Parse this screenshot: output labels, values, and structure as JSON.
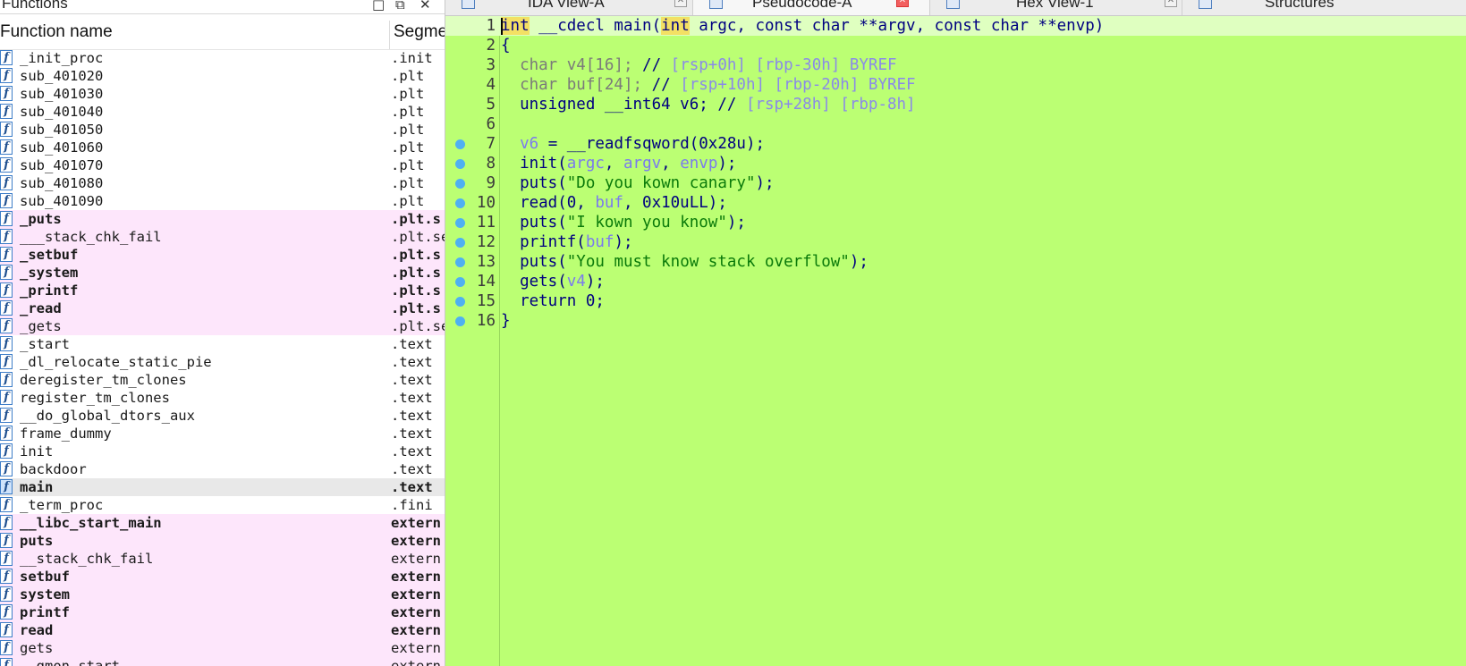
{
  "functions_panel": {
    "title": "Functions",
    "col_name": "Function name",
    "col_segment": "Segme",
    "rows": [
      {
        "name": "_init_proc",
        "segment": ".init",
        "style": "normal"
      },
      {
        "name": "sub_401020",
        "segment": ".plt",
        "style": "normal"
      },
      {
        "name": "sub_401030",
        "segment": ".plt",
        "style": "normal"
      },
      {
        "name": "sub_401040",
        "segment": ".plt",
        "style": "normal"
      },
      {
        "name": "sub_401050",
        "segment": ".plt",
        "style": "normal"
      },
      {
        "name": "sub_401060",
        "segment": ".plt",
        "style": "normal"
      },
      {
        "name": "sub_401070",
        "segment": ".plt",
        "style": "normal"
      },
      {
        "name": "sub_401080",
        "segment": ".plt",
        "style": "normal"
      },
      {
        "name": "sub_401090",
        "segment": ".plt",
        "style": "normal"
      },
      {
        "name": "_puts",
        "segment": ".plt.s",
        "style": "lib-bold"
      },
      {
        "name": "___stack_chk_fail",
        "segment": ".plt.se",
        "style": "lib"
      },
      {
        "name": "_setbuf",
        "segment": ".plt.s",
        "style": "lib-bold"
      },
      {
        "name": "_system",
        "segment": ".plt.s",
        "style": "lib-bold"
      },
      {
        "name": "_printf",
        "segment": ".plt.s",
        "style": "lib-bold"
      },
      {
        "name": "_read",
        "segment": ".plt.s",
        "style": "lib-bold"
      },
      {
        "name": "_gets",
        "segment": ".plt.se",
        "style": "lib"
      },
      {
        "name": "_start",
        "segment": ".text",
        "style": "normal"
      },
      {
        "name": "_dl_relocate_static_pie",
        "segment": ".text",
        "style": "normal"
      },
      {
        "name": "deregister_tm_clones",
        "segment": ".text",
        "style": "normal"
      },
      {
        "name": "register_tm_clones",
        "segment": ".text",
        "style": "normal"
      },
      {
        "name": "__do_global_dtors_aux",
        "segment": ".text",
        "style": "normal"
      },
      {
        "name": "frame_dummy",
        "segment": ".text",
        "style": "normal"
      },
      {
        "name": "init",
        "segment": ".text",
        "style": "normal"
      },
      {
        "name": "backdoor",
        "segment": ".text",
        "style": "normal"
      },
      {
        "name": "main",
        "segment": ".text",
        "style": "selected-bold"
      },
      {
        "name": "_term_proc",
        "segment": ".fini",
        "style": "normal"
      },
      {
        "name": "__libc_start_main",
        "segment": "extern",
        "style": "lib-bold"
      },
      {
        "name": "puts",
        "segment": "extern",
        "style": "lib-bold"
      },
      {
        "name": "__stack_chk_fail",
        "segment": "extern",
        "style": "lib"
      },
      {
        "name": "setbuf",
        "segment": "extern",
        "style": "lib-bold"
      },
      {
        "name": "system",
        "segment": "extern",
        "style": "lib-bold"
      },
      {
        "name": "printf",
        "segment": "extern",
        "style": "lib-bold"
      },
      {
        "name": "read",
        "segment": "extern",
        "style": "lib-bold"
      },
      {
        "name": "gets",
        "segment": "extern",
        "style": "lib"
      },
      {
        "name": "__gmon_start__",
        "segment": "extern",
        "style": "lib"
      }
    ]
  },
  "tabs": [
    {
      "label": "IDA View-A",
      "active": false,
      "closable": true
    },
    {
      "label": "Pseudocode-A",
      "active": true,
      "closable": true
    },
    {
      "label": "Hex View-1",
      "active": false,
      "closable": true
    },
    {
      "label": "Structures",
      "active": false,
      "closable": false
    }
  ],
  "code": {
    "lines": [
      {
        "n": "1",
        "dot": false,
        "tokens": [
          [
            "kwhl",
            "int"
          ],
          [
            "kw",
            " __cdecl main("
          ],
          [
            "kwhl",
            "int"
          ],
          [
            "kw",
            " argc, const char **argv, const char **envp)"
          ]
        ]
      },
      {
        "n": "2",
        "dot": false,
        "tokens": [
          [
            "kw",
            "{"
          ]
        ]
      },
      {
        "n": "3",
        "dot": false,
        "tokens": [
          [
            "gr",
            "  char v4[16]; "
          ],
          [
            "kw",
            "// "
          ],
          [
            "cm",
            "[rsp+0h] [rbp-30h] BYREF"
          ]
        ]
      },
      {
        "n": "4",
        "dot": false,
        "tokens": [
          [
            "gr",
            "  char buf[24]; "
          ],
          [
            "kw",
            "// "
          ],
          [
            "cm",
            "[rsp+10h] [rbp-20h] BYREF"
          ]
        ]
      },
      {
        "n": "5",
        "dot": false,
        "tokens": [
          [
            "kw",
            "  unsigned __int64 v6; // "
          ],
          [
            "cm",
            "[rsp+28h] [rbp-8h]"
          ]
        ]
      },
      {
        "n": "6",
        "dot": false,
        "tokens": [
          [
            "kw",
            ""
          ]
        ]
      },
      {
        "n": "7",
        "dot": true,
        "tokens": [
          [
            "vr",
            "  v6"
          ],
          [
            "kw",
            " = __readfsqword(0x28u);"
          ]
        ]
      },
      {
        "n": "8",
        "dot": true,
        "tokens": [
          [
            "kw",
            "  init("
          ],
          [
            "vr",
            "argc"
          ],
          [
            "kw",
            ", "
          ],
          [
            "vr",
            "argv"
          ],
          [
            "kw",
            ", "
          ],
          [
            "vr",
            "envp"
          ],
          [
            "kw",
            ");"
          ]
        ]
      },
      {
        "n": "9",
        "dot": true,
        "tokens": [
          [
            "kw",
            "  puts("
          ],
          [
            "st",
            "\"Do you kown canary\""
          ],
          [
            "kw",
            ");"
          ]
        ]
      },
      {
        "n": "10",
        "dot": true,
        "tokens": [
          [
            "kw",
            "  read(0, "
          ],
          [
            "vr",
            "buf"
          ],
          [
            "kw",
            ", 0x10uLL);"
          ]
        ]
      },
      {
        "n": "11",
        "dot": true,
        "tokens": [
          [
            "kw",
            "  puts("
          ],
          [
            "st",
            "\"I kown you know\""
          ],
          [
            "kw",
            ");"
          ]
        ]
      },
      {
        "n": "12",
        "dot": true,
        "tokens": [
          [
            "kw",
            "  printf("
          ],
          [
            "vr",
            "buf"
          ],
          [
            "kw",
            ");"
          ]
        ]
      },
      {
        "n": "13",
        "dot": true,
        "tokens": [
          [
            "kw",
            "  puts("
          ],
          [
            "st",
            "\"You must know stack overflow\""
          ],
          [
            "kw",
            ");"
          ]
        ]
      },
      {
        "n": "14",
        "dot": true,
        "tokens": [
          [
            "kw",
            "  gets("
          ],
          [
            "vr",
            "v4"
          ],
          [
            "kw",
            ");"
          ]
        ]
      },
      {
        "n": "15",
        "dot": true,
        "tokens": [
          [
            "kw",
            "  return 0;"
          ]
        ]
      },
      {
        "n": "16",
        "dot": true,
        "tokens": [
          [
            "kw",
            "}"
          ]
        ]
      }
    ]
  }
}
